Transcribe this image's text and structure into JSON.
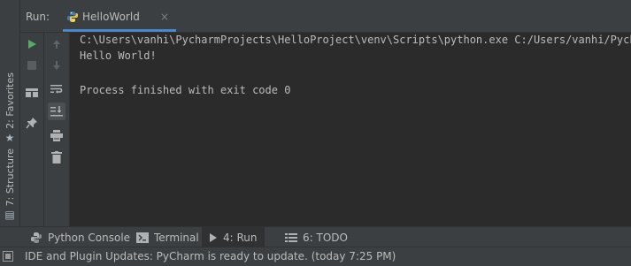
{
  "left_strip": {
    "favorites_label": "Favorites",
    "favorites_number": "2:",
    "structure_label": "Structure",
    "structure_number": "7:"
  },
  "run_panel": {
    "label": "Run:",
    "tab": {
      "title": "HelloWorld",
      "close": "×"
    }
  },
  "console": {
    "lines": [
      "C:\\Users\\vanhi\\PycharmProjects\\HelloProject\\venv\\Scripts\\python.exe C:/Users/vanhi/PycharmProjects/HelloProject/HelloWorld.py",
      "Hello World!",
      "",
      "Process finished with exit code 0"
    ]
  },
  "tool_windows": [
    {
      "label": "Python Console",
      "icon": "python-console-icon"
    },
    {
      "label": "Terminal",
      "icon": "terminal-icon"
    },
    {
      "label": "4: Run",
      "icon": "run-icon"
    },
    {
      "label": "6: TODO",
      "icon": "todo-icon"
    }
  ],
  "status_bar": {
    "message": "IDE and Plugin Updates: PyCharm is ready to update. (today 7:25 PM)"
  },
  "colors": {
    "background": "#2b2b2b",
    "panel": "#3c3f41",
    "accent": "#4a88c7",
    "run_green": "#59a869",
    "text": "#bbbbbb"
  }
}
